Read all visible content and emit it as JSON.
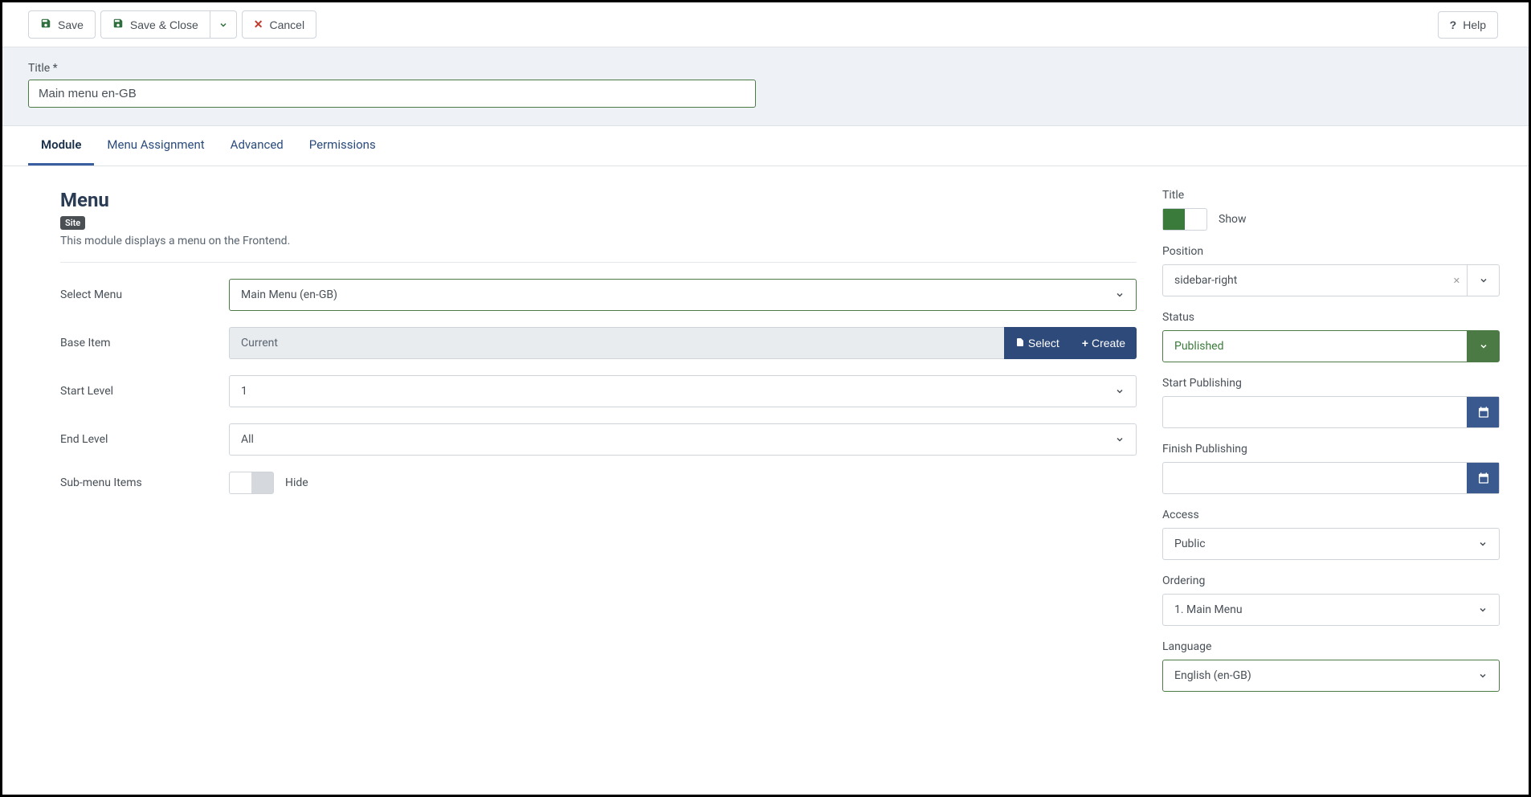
{
  "toolbar": {
    "save": "Save",
    "save_close": "Save & Close",
    "cancel": "Cancel",
    "help": "Help"
  },
  "title_field": {
    "label": "Title *",
    "value": "Main menu en-GB"
  },
  "tabs": {
    "module": "Module",
    "menu_assignment": "Menu Assignment",
    "advanced": "Advanced",
    "permissions": "Permissions"
  },
  "module": {
    "heading": "Menu",
    "site_badge": "Site",
    "description": "This module displays a menu on the Frontend.",
    "fields": {
      "select_menu": {
        "label": "Select Menu",
        "value": "Main Menu (en-GB)"
      },
      "base_item": {
        "label": "Base Item",
        "value": "Current",
        "select": "Select",
        "create": "Create"
      },
      "start_level": {
        "label": "Start Level",
        "value": "1"
      },
      "end_level": {
        "label": "End Level",
        "value": "All"
      },
      "sub_menu": {
        "label": "Sub-menu Items",
        "value": "Hide"
      }
    }
  },
  "sidebar": {
    "title_toggle": {
      "label": "Title",
      "value": "Show"
    },
    "position": {
      "label": "Position",
      "value": "sidebar-right"
    },
    "status": {
      "label": "Status",
      "value": "Published"
    },
    "start_pub": {
      "label": "Start Publishing",
      "value": ""
    },
    "finish_pub": {
      "label": "Finish Publishing",
      "value": ""
    },
    "access": {
      "label": "Access",
      "value": "Public"
    },
    "ordering": {
      "label": "Ordering",
      "value": "1. Main Menu"
    },
    "language": {
      "label": "Language",
      "value": "English (en-GB)"
    }
  }
}
